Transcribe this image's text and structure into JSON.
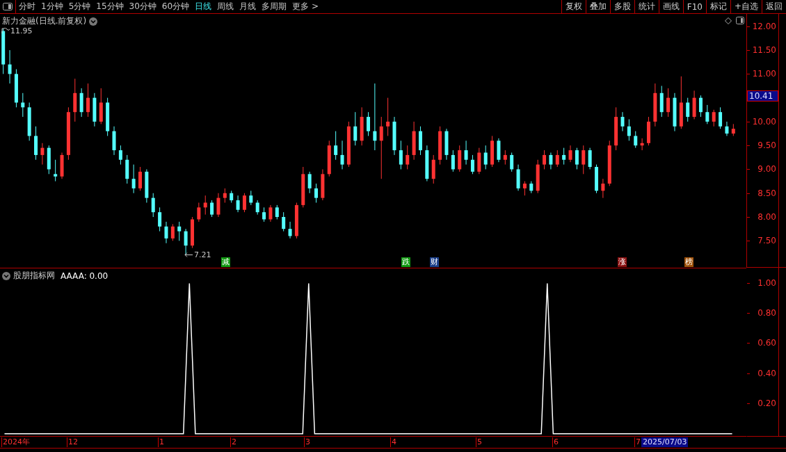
{
  "toolbar": {
    "periods": [
      {
        "label": "分时",
        "selected": false
      },
      {
        "label": "1分钟",
        "selected": false
      },
      {
        "label": "5分钟",
        "selected": false
      },
      {
        "label": "15分钟",
        "selected": false
      },
      {
        "label": "30分钟",
        "selected": false
      },
      {
        "label": "60分钟",
        "selected": false
      },
      {
        "label": "日线",
        "selected": true
      },
      {
        "label": "周线",
        "selected": false
      },
      {
        "label": "月线",
        "selected": false
      },
      {
        "label": "多周期",
        "selected": false
      },
      {
        "label": "更多 >",
        "selected": false
      }
    ],
    "actions": [
      "复权",
      "叠加",
      "多股",
      "统计",
      "画线",
      "F10",
      "标记",
      "+自选",
      "返回"
    ]
  },
  "price_pane": {
    "title": "新力金融(日线.前复权)",
    "high_label": "11.95",
    "low_label": "7.21",
    "markers": [
      {
        "text": "减",
        "color": "#119911"
      },
      {
        "text": "跌",
        "color": "#119911"
      },
      {
        "text": "财",
        "color": "#1b3f8a"
      },
      {
        "text": "涨",
        "color": "#8b1010"
      },
      {
        "text": "榜",
        "color": "#a0520a"
      }
    ],
    "current_price": "10.41",
    "chart_data": {
      "type": "candlestick",
      "ylim": [
        6.95,
        12.26
      ],
      "yticks": [
        {
          "value": 12,
          "label": "12.00"
        },
        {
          "value": 11.5,
          "label": "11.50"
        },
        {
          "value": 11,
          "label": "11.00"
        },
        {
          "value": 10,
          "label": "10.00"
        },
        {
          "value": 9.5,
          "label": "9.50"
        },
        {
          "value": 9,
          "label": "9.00"
        },
        {
          "value": 8.5,
          "label": "8.50"
        },
        {
          "value": 8,
          "label": "8.00"
        },
        {
          "value": 7.5,
          "label": "7.50"
        }
      ],
      "categories": [
        null,
        null,
        null,
        null,
        null,
        null,
        null,
        null,
        null,
        null,
        null,
        null,
        null,
        null,
        null,
        null,
        null,
        null,
        null,
        null,
        null,
        null,
        null,
        null,
        null,
        null,
        null,
        null,
        null,
        null,
        null,
        null,
        null,
        null,
        null,
        null,
        null,
        null,
        null,
        null,
        null,
        null,
        null,
        null,
        null,
        null,
        null,
        null,
        null,
        null,
        null,
        null,
        null,
        null,
        null,
        null,
        null,
        null,
        null,
        null,
        null,
        null,
        null,
        null,
        null,
        null,
        null,
        null,
        null,
        null,
        null,
        null,
        null,
        null,
        null,
        null,
        null,
        null,
        null,
        null,
        null,
        null,
        null,
        null,
        null,
        null,
        null,
        null,
        null,
        null,
        null,
        null,
        null,
        null,
        null,
        null,
        null,
        null,
        null,
        null,
        null,
        null,
        null,
        null,
        null,
        null,
        null,
        null,
        null,
        null,
        null,
        null,
        null
      ],
      "ohlc": [
        [
          11.9,
          11.95,
          11.0,
          11.2
        ],
        [
          11.2,
          11.5,
          10.8,
          11.0
        ],
        [
          11.0,
          11.1,
          10.3,
          10.4
        ],
        [
          10.4,
          10.6,
          10.1,
          10.3
        ],
        [
          10.3,
          10.4,
          9.6,
          9.7
        ],
        [
          9.7,
          9.9,
          9.2,
          9.3
        ],
        [
          9.3,
          9.55,
          9.1,
          9.45
        ],
        [
          9.45,
          9.5,
          8.9,
          9.0
        ],
        [
          8.9,
          9.2,
          8.75,
          8.85
        ],
        [
          8.85,
          9.35,
          8.8,
          9.3
        ],
        [
          9.3,
          10.3,
          9.2,
          10.2
        ],
        [
          10.2,
          10.9,
          10.0,
          10.6
        ],
        [
          10.6,
          10.7,
          10.1,
          10.2
        ],
        [
          10.2,
          10.8,
          10.1,
          10.5
        ],
        [
          10.5,
          10.6,
          9.9,
          10.0
        ],
        [
          10.0,
          10.7,
          9.95,
          10.4
        ],
        [
          10.4,
          10.5,
          9.7,
          9.8
        ],
        [
          9.8,
          9.9,
          9.3,
          9.4
        ],
        [
          9.4,
          9.5,
          9.1,
          9.2
        ],
        [
          9.2,
          9.3,
          8.7,
          8.8
        ],
        [
          8.8,
          9.1,
          8.5,
          8.6
        ],
        [
          8.6,
          9.05,
          8.55,
          8.95
        ],
        [
          8.95,
          9.0,
          8.3,
          8.4
        ],
        [
          8.4,
          8.5,
          8.0,
          8.1
        ],
        [
          8.1,
          8.2,
          7.7,
          7.8
        ],
        [
          7.8,
          7.9,
          7.45,
          7.55
        ],
        [
          7.55,
          7.85,
          7.5,
          7.8
        ],
        [
          7.8,
          7.9,
          7.5,
          7.7
        ],
        [
          7.7,
          7.75,
          7.21,
          7.4
        ],
        [
          7.4,
          8.0,
          7.35,
          7.95
        ],
        [
          7.95,
          8.3,
          7.9,
          8.2
        ],
        [
          8.2,
          8.45,
          8.05,
          8.3
        ],
        [
          8.3,
          8.35,
          8.0,
          8.05
        ],
        [
          8.05,
          8.5,
          8.0,
          8.4
        ],
        [
          8.4,
          8.6,
          8.3,
          8.5
        ],
        [
          8.5,
          8.55,
          8.3,
          8.35
        ],
        [
          8.35,
          8.45,
          8.1,
          8.15
        ],
        [
          8.15,
          8.5,
          8.1,
          8.45
        ],
        [
          8.45,
          8.55,
          8.25,
          8.3
        ],
        [
          8.3,
          8.35,
          8.05,
          8.1
        ],
        [
          8.1,
          8.2,
          7.9,
          7.95
        ],
        [
          7.95,
          8.25,
          7.9,
          8.2
        ],
        [
          8.2,
          8.25,
          7.95,
          8.0
        ],
        [
          8.0,
          8.1,
          7.7,
          7.75
        ],
        [
          7.75,
          7.9,
          7.55,
          7.6
        ],
        [
          7.6,
          8.3,
          7.55,
          8.25
        ],
        [
          8.25,
          9.05,
          8.2,
          8.9
        ],
        [
          8.9,
          8.95,
          8.5,
          8.6
        ],
        [
          8.6,
          8.7,
          8.3,
          8.4
        ],
        [
          8.4,
          9.0,
          8.35,
          8.9
        ],
        [
          8.9,
          9.6,
          8.85,
          9.5
        ],
        [
          9.5,
          9.8,
          9.2,
          9.3
        ],
        [
          9.3,
          9.6,
          9.0,
          9.1
        ],
        [
          9.1,
          10.0,
          9.05,
          9.9
        ],
        [
          9.9,
          10.2,
          9.5,
          9.6
        ],
        [
          9.6,
          10.3,
          9.5,
          10.1
        ],
        [
          10.1,
          10.2,
          9.7,
          9.8
        ],
        [
          9.8,
          10.8,
          9.4,
          9.6
        ],
        [
          9.6,
          10.1,
          8.8,
          9.9
        ],
        [
          9.9,
          10.5,
          9.7,
          10.0
        ],
        [
          10.0,
          10.1,
          9.3,
          9.4
        ],
        [
          9.4,
          9.6,
          9.0,
          9.1
        ],
        [
          9.1,
          9.5,
          9.0,
          9.3
        ],
        [
          9.3,
          10.0,
          9.2,
          9.8
        ],
        [
          9.8,
          9.9,
          9.3,
          9.4
        ],
        [
          9.4,
          9.5,
          8.75,
          8.8
        ],
        [
          8.8,
          9.3,
          8.7,
          9.2
        ],
        [
          9.2,
          9.9,
          9.1,
          9.8
        ],
        [
          9.8,
          9.85,
          9.2,
          9.3
        ],
        [
          9.3,
          9.4,
          8.95,
          9.0
        ],
        [
          9.0,
          9.5,
          8.95,
          9.4
        ],
        [
          9.4,
          9.6,
          9.1,
          9.2
        ],
        [
          9.2,
          9.3,
          8.9,
          8.95
        ],
        [
          8.95,
          9.45,
          8.9,
          9.35
        ],
        [
          9.35,
          9.5,
          9.0,
          9.1
        ],
        [
          9.1,
          9.7,
          9.05,
          9.6
        ],
        [
          9.6,
          9.65,
          9.15,
          9.2
        ],
        [
          9.2,
          9.4,
          9.1,
          9.3
        ],
        [
          9.3,
          9.35,
          8.95,
          9.0
        ],
        [
          9.0,
          9.1,
          8.55,
          8.6
        ],
        [
          8.6,
          8.75,
          8.45,
          8.7
        ],
        [
          8.7,
          8.75,
          8.5,
          8.55
        ],
        [
          8.55,
          9.2,
          8.5,
          9.1
        ],
        [
          9.1,
          9.4,
          9.0,
          9.3
        ],
        [
          9.3,
          9.35,
          9.0,
          9.1
        ],
        [
          9.1,
          9.4,
          9.05,
          9.3
        ],
        [
          9.3,
          9.45,
          9.1,
          9.2
        ],
        [
          9.2,
          9.5,
          9.15,
          9.4
        ],
        [
          9.4,
          9.45,
          9.0,
          9.1
        ],
        [
          9.1,
          9.5,
          8.9,
          9.4
        ],
        [
          9.4,
          9.45,
          9.0,
          9.05
        ],
        [
          9.05,
          9.1,
          8.5,
          8.55
        ],
        [
          8.55,
          8.8,
          8.4,
          8.7
        ],
        [
          8.7,
          9.6,
          8.65,
          9.5
        ],
        [
          9.5,
          10.3,
          9.4,
          10.1
        ],
        [
          10.1,
          10.2,
          9.8,
          9.9
        ],
        [
          9.9,
          10.05,
          9.6,
          9.7
        ],
        [
          9.7,
          9.8,
          9.45,
          9.5
        ],
        [
          9.5,
          9.65,
          9.4,
          9.55
        ],
        [
          9.55,
          10.1,
          9.5,
          10.0
        ],
        [
          10.0,
          10.8,
          9.9,
          10.6
        ],
        [
          10.6,
          10.75,
          10.1,
          10.2
        ],
        [
          10.2,
          10.7,
          10.1,
          10.5
        ],
        [
          10.5,
          10.6,
          9.8,
          9.9
        ],
        [
          9.9,
          10.95,
          9.85,
          10.4
        ],
        [
          10.4,
          10.5,
          10.0,
          10.1
        ],
        [
          10.1,
          10.65,
          10.05,
          10.5
        ],
        [
          10.5,
          10.55,
          10.1,
          10.2
        ],
        [
          10.2,
          10.35,
          9.95,
          10.0
        ],
        [
          10.0,
          10.25,
          9.9,
          10.2
        ],
        [
          10.2,
          10.3,
          9.85,
          9.9
        ],
        [
          9.9,
          10.0,
          9.7,
          9.75
        ],
        [
          9.75,
          9.95,
          9.7,
          9.85
        ]
      ]
    }
  },
  "indicator_pane": {
    "name": "股朋指标网",
    "reading": "AAAA: 0.00",
    "chart_data": {
      "type": "line",
      "categories": [
        null,
        null,
        null,
        null,
        null,
        null,
        null,
        null,
        null,
        null,
        null,
        null,
        null,
        null,
        null,
        null,
        null,
        null,
        null,
        null,
        null,
        null,
        null,
        null,
        null,
        null,
        null,
        null,
        null,
        null,
        null,
        null,
        null,
        null,
        null,
        null,
        null,
        null,
        null,
        null,
        null,
        null,
        null,
        null,
        null,
        null,
        null,
        null,
        null,
        null,
        null,
        null,
        null,
        null,
        null,
        null,
        null,
        null,
        null,
        null,
        null,
        null,
        null,
        null,
        null,
        null,
        null,
        null,
        null,
        null,
        null,
        null,
        null,
        null,
        null,
        null,
        null,
        null,
        null,
        null,
        null,
        null,
        null,
        null,
        null,
        null,
        null,
        null,
        null,
        null,
        null,
        null,
        null,
        null,
        null,
        null,
        null,
        null,
        null,
        null,
        null,
        null,
        null,
        null,
        null,
        null,
        null,
        null,
        null,
        null,
        null,
        null,
        null,
        null,
        null,
        null,
        null,
        null,
        null,
        null,
        null,
        null,
        null
      ],
      "ylim": [
        -0.02,
        1.1
      ],
      "series": [
        {
          "color": "#ffffff",
          "values": [
            0,
            0,
            0,
            0,
            0,
            0,
            0,
            0,
            0,
            0,
            0,
            0,
            0,
            0,
            0,
            0,
            0,
            0,
            0,
            0,
            0,
            0,
            0,
            0,
            0,
            0,
            0,
            0,
            0,
            0,
            0,
            1,
            0,
            0,
            0,
            0,
            0,
            0,
            0,
            0,
            0,
            0,
            0,
            0,
            0,
            0,
            0,
            0,
            0,
            0,
            0,
            1,
            0,
            0,
            0,
            0,
            0,
            0,
            0,
            0,
            0,
            0,
            0,
            0,
            0,
            0,
            0,
            0,
            0,
            0,
            0,
            0,
            0,
            0,
            0,
            0,
            0,
            0,
            0,
            0,
            0,
            0,
            0,
            0,
            0,
            0,
            0,
            0,
            0,
            0,
            0,
            1,
            0,
            0,
            0,
            0,
            0,
            0,
            0,
            0,
            0,
            0,
            0,
            0,
            0,
            0,
            0,
            0,
            0,
            0,
            0,
            0,
            0,
            0,
            0,
            0,
            0,
            0,
            0,
            0,
            0,
            0,
            0
          ]
        }
      ],
      "yticks": [
        {
          "value": 1.0,
          "label": "1.00"
        },
        {
          "value": 0.8,
          "label": "0.80"
        },
        {
          "value": 0.6,
          "label": "0.60"
        },
        {
          "value": 0.4,
          "label": "0.40"
        },
        {
          "value": 0.2,
          "label": "0.20"
        }
      ]
    }
  },
  "time_axis": {
    "labels": [
      "2024年",
      "12",
      "1",
      "2",
      "3",
      "4",
      "5",
      "6",
      "7"
    ],
    "current_date": "2025/07/03"
  }
}
